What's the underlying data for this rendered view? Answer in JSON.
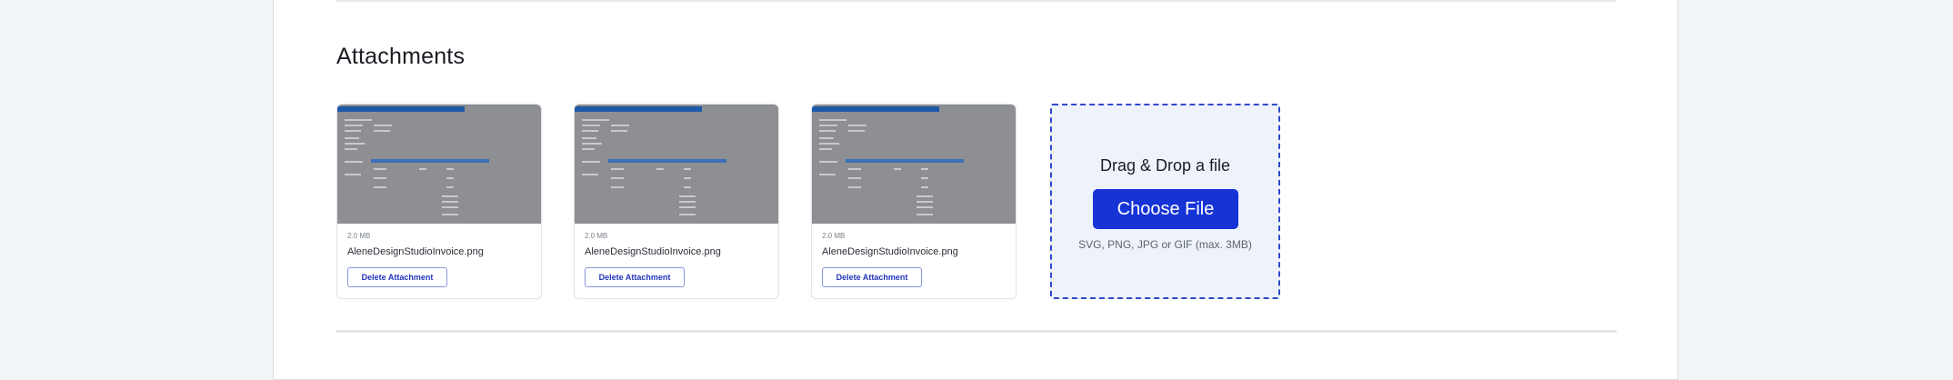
{
  "section": {
    "title": "Attachments"
  },
  "attachments": [
    {
      "size": "2.0 MB",
      "filename": "AleneDesignStudioInvoice.png",
      "delete_label": "Delete Attachment"
    },
    {
      "size": "2.0 MB",
      "filename": "AleneDesignStudioInvoice.png",
      "delete_label": "Delete Attachment"
    },
    {
      "size": "2.0 MB",
      "filename": "AleneDesignStudioInvoice.png",
      "delete_label": "Delete Attachment"
    }
  ],
  "upload": {
    "title": "Drag & Drop a file",
    "button_label": "Choose File",
    "hint": "SVG, PNG, JPG or GIF (max. 3MB)"
  },
  "colors": {
    "accent": "#1633d6",
    "dropzone_border": "#3048c9",
    "dropzone_bg": "#eef3fb",
    "page_bg": "#f1f5f7"
  }
}
